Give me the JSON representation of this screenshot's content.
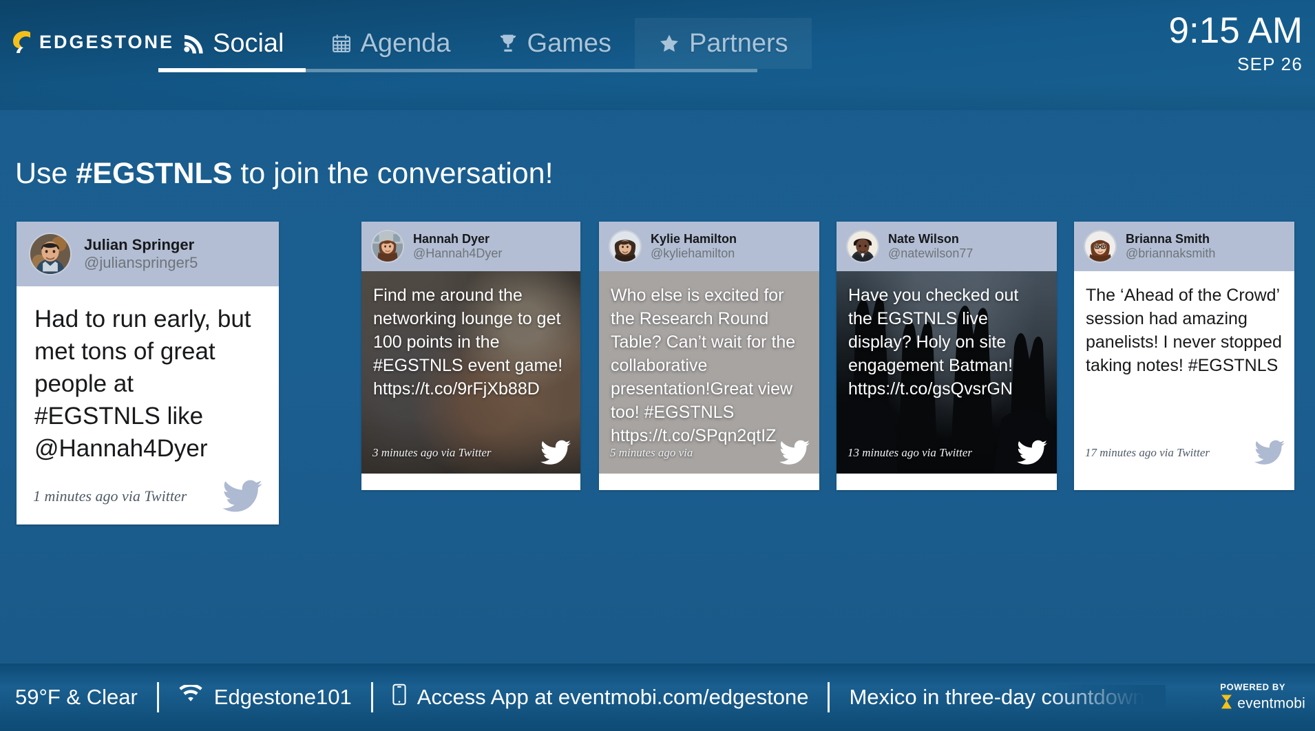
{
  "header": {
    "brand_name": "EDGESTONE",
    "brand_icon": "edgestone-leaf-logo",
    "tabs": [
      {
        "label": "Social",
        "icon": "rss-icon",
        "active": true,
        "highlight": false
      },
      {
        "label": "Agenda",
        "icon": "calendar-icon",
        "active": false,
        "highlight": false
      },
      {
        "label": "Games",
        "icon": "trophy-icon",
        "active": false,
        "highlight": false
      },
      {
        "label": "Partners",
        "icon": "star-icon",
        "active": false,
        "highlight": true
      }
    ],
    "clock": {
      "time": "9:15 AM",
      "date": "SEP 26"
    }
  },
  "headline": {
    "prefix": "Use ",
    "hashtag": "#EGSTNLS",
    "suffix": " to join the conversation!"
  },
  "cards": [
    {
      "name": "Julian Springer",
      "handle": "@julianspringer5",
      "text": "Had to run early, but met tons of great people at #EGSTNLS like @Hannah4Dyer",
      "ago": "1 minutes ago via Twitter",
      "bird_icon": "twitter-bird-icon",
      "avatar_icon": "avatar-julian-springer",
      "has_photo": false
    },
    {
      "name": "Hannah Dyer",
      "handle": "@Hannah4Dyer",
      "text": "Find me around the networking lounge to get 100 points in the #EGSTNLS event game! https://t.co/9rFjXb88D",
      "ago": "3 minutes ago via Twitter",
      "bird_icon": "twitter-bird-icon",
      "avatar_icon": "avatar-hannah-dyer",
      "has_photo": true
    },
    {
      "name": "Kylie Hamilton",
      "handle": "@kyliehamilton",
      "text": "Who else is excited for the Research Round Table? Can’t wait for the collaborative presentation!Great view too! #EGSTNLS https://t.co/SPqn2qtIZ",
      "ago": "5 minutes ago via",
      "bird_icon": "twitter-bird-icon",
      "avatar_icon": "avatar-kylie-hamilton",
      "has_photo": true
    },
    {
      "name": "Nate Wilson",
      "handle": "@natewilson77",
      "text": "Have you checked out the EGSTNLS live display? Holy on site engagement Batman! https://t.co/gsQvsrGN",
      "ago": "13 minutes ago via Twitter",
      "bird_icon": "twitter-bird-icon",
      "avatar_icon": "avatar-nate-wilson",
      "has_photo": true
    },
    {
      "name": "Brianna Smith",
      "handle": "@briannaksmith",
      "text": "The ‘Ahead of the Crowd’ session had amazing panelists! I never stopped taking notes! #EGSTNLS",
      "ago": "17 minutes ago via Twitter",
      "bird_icon": "twitter-bird-icon",
      "avatar_icon": "avatar-brianna-smith",
      "has_photo": false
    }
  ],
  "footer": {
    "weather": "59°F & Clear",
    "wifi": {
      "icon": "wifi-icon",
      "label": "Edgestone101"
    },
    "app": {
      "icon": "mobile-phone-icon",
      "label": "Access App at eventmobi.com/edgestone"
    },
    "ticker": "Mexico in three-day countdown",
    "powered_by_label": "POWERED BY",
    "powered_by_name": "eventmobi",
    "powered_by_icon": "eventmobi-logo-icon"
  },
  "colors": {
    "background": "#1b5c8c",
    "header": "#0e4b76",
    "accent_yellow": "#f4c11a",
    "card_head": "#b3bed4",
    "twitter_blue": "#aeb9d2"
  }
}
